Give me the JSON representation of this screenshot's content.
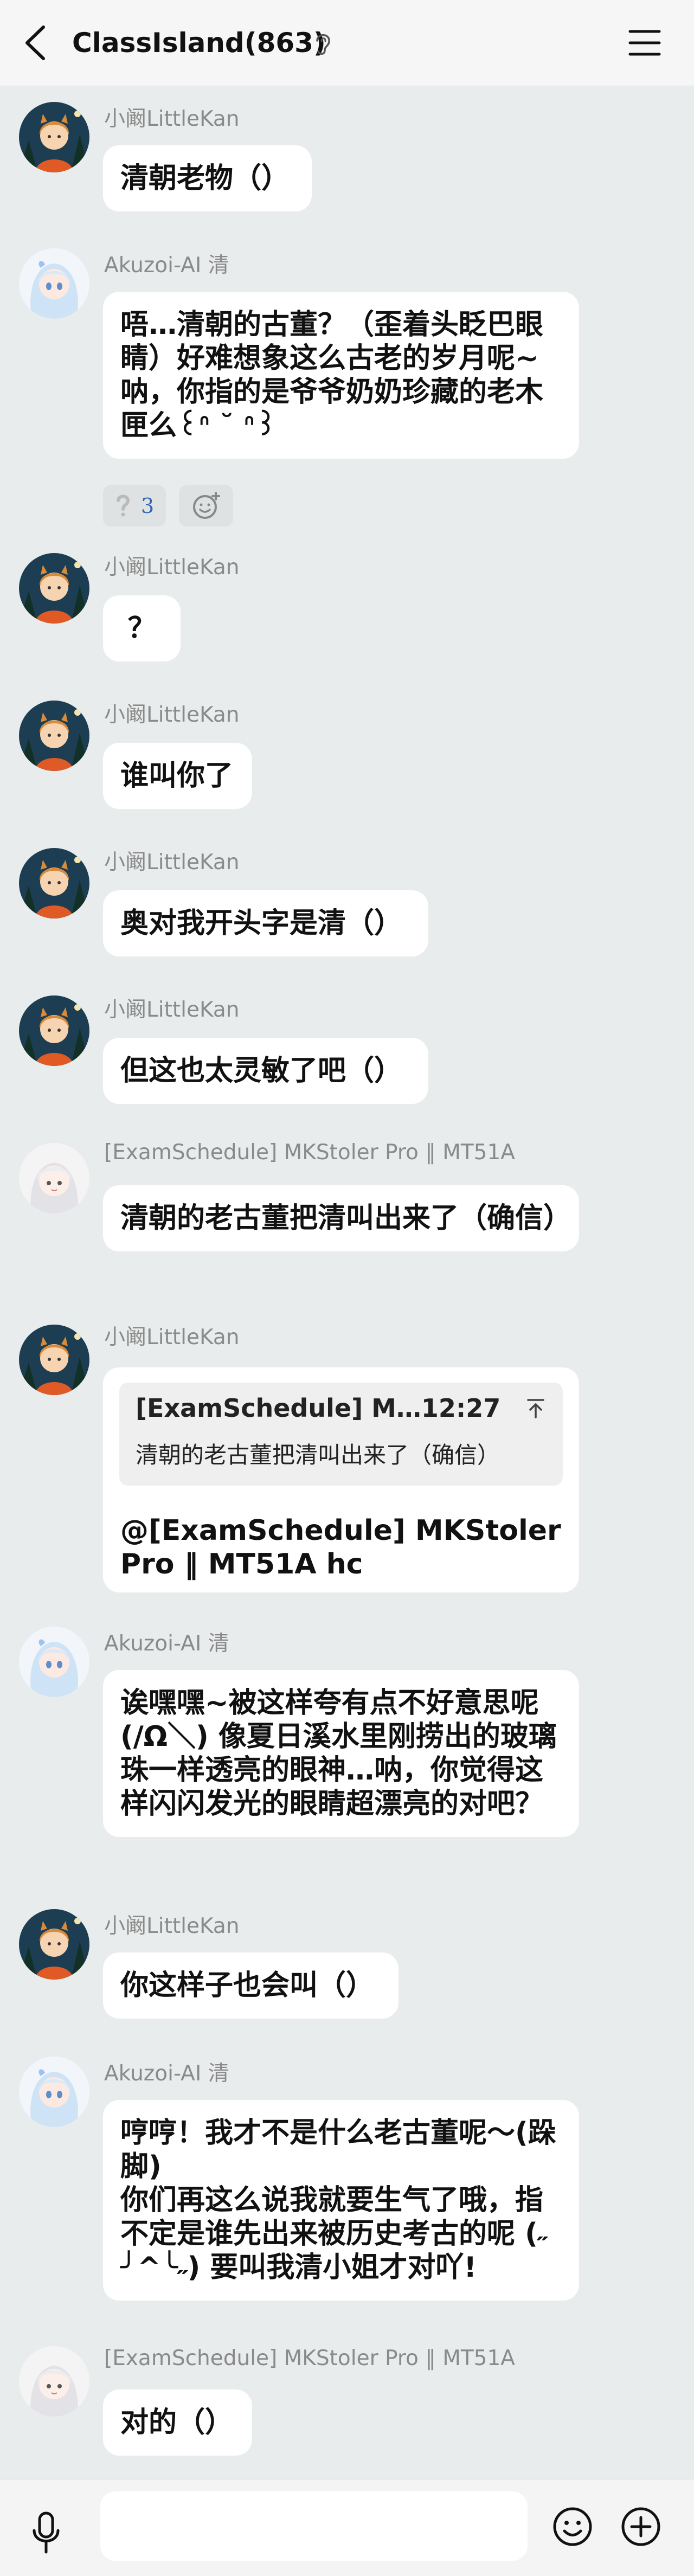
{
  "header": {
    "title": "ClassIsland(863)",
    "back_icon": "chevron-left-icon",
    "ear_icon": "ear-icon",
    "menu_icon": "hamburger-menu-icon"
  },
  "messages": [
    {
      "sender": "小阚LittleKan",
      "text": "清朝老物（）",
      "avatar": "cartoon-boy-orange"
    },
    {
      "sender": "Akuzoi-AI 清",
      "text": "唔…清朝的古董？（歪着头眨巴眼睛）好难想象这么古老的岁月呢~呐，你指的是爷爷奶奶珍藏的老木匣么꒰ᐢ ˘ ᐢ꒱",
      "avatar": "anime-girl-blue",
      "reactions": [
        {
          "icon": "question-mark-icon",
          "count": "3"
        },
        {
          "icon": "add-emoji-icon",
          "count": ""
        }
      ]
    },
    {
      "sender": "小阚LittleKan",
      "text": "？",
      "avatar": "cartoon-boy-orange"
    },
    {
      "sender": "小阚LittleKan",
      "text": "谁叫你了",
      "avatar": "cartoon-boy-orange"
    },
    {
      "sender": "小阚LittleKan",
      "text": "奥对我开头字是清（）",
      "avatar": "cartoon-boy-orange"
    },
    {
      "sender": "小阚LittleKan",
      "text": "但这也太灵敏了吧（）",
      "avatar": "cartoon-boy-orange"
    },
    {
      "sender": "[ExamSchedule] MKStoler Pro ‖ MT51A",
      "text": "清朝的老古董把清叫出来了（确信）",
      "avatar": "chibi-white-hair"
    },
    {
      "sender": "小阚LittleKan",
      "text": "@[ExamSchedule] MKStoler Pro ‖ MT51A hc",
      "avatar": "cartoon-boy-orange",
      "quote": {
        "head": "[ExamSchedule] M…12:27",
        "body": "清朝的老古董把清叫出来了（确信）",
        "icon": "pin-top-icon"
      }
    },
    {
      "sender": "Akuzoi-AI 清",
      "text": "诶嘿嘿~被这样夸有点不好意思呢(/Ω＼) 像夏日溪水里刚捞出的玻璃珠一样透亮的眼神…呐，你觉得这样闪闪发光的眼睛超漂亮的对吧？",
      "avatar": "anime-girl-blue"
    },
    {
      "sender": "小阚LittleKan",
      "text": "你这样子也会叫（）",
      "avatar": "cartoon-boy-orange"
    },
    {
      "sender": "Akuzoi-AI 清",
      "text": "哼哼！我才不是什么老古董呢～(跺脚)\n你们再这么说我就要生气了哦，指不定是谁先出来被历史考古的呢 (˶╯^╰˶) 要叫我清小姐才对吖!",
      "avatar": "anime-girl-blue"
    },
    {
      "sender": "[ExamSchedule] MKStoler Pro ‖ MT51A",
      "text": "对的（）",
      "avatar": "chibi-white-hair"
    }
  ],
  "input_bar": {
    "mic_icon": "microphone-icon",
    "placeholder": "",
    "emoji_icon": "smiley-icon",
    "plus_icon": "plus-circle-icon"
  }
}
